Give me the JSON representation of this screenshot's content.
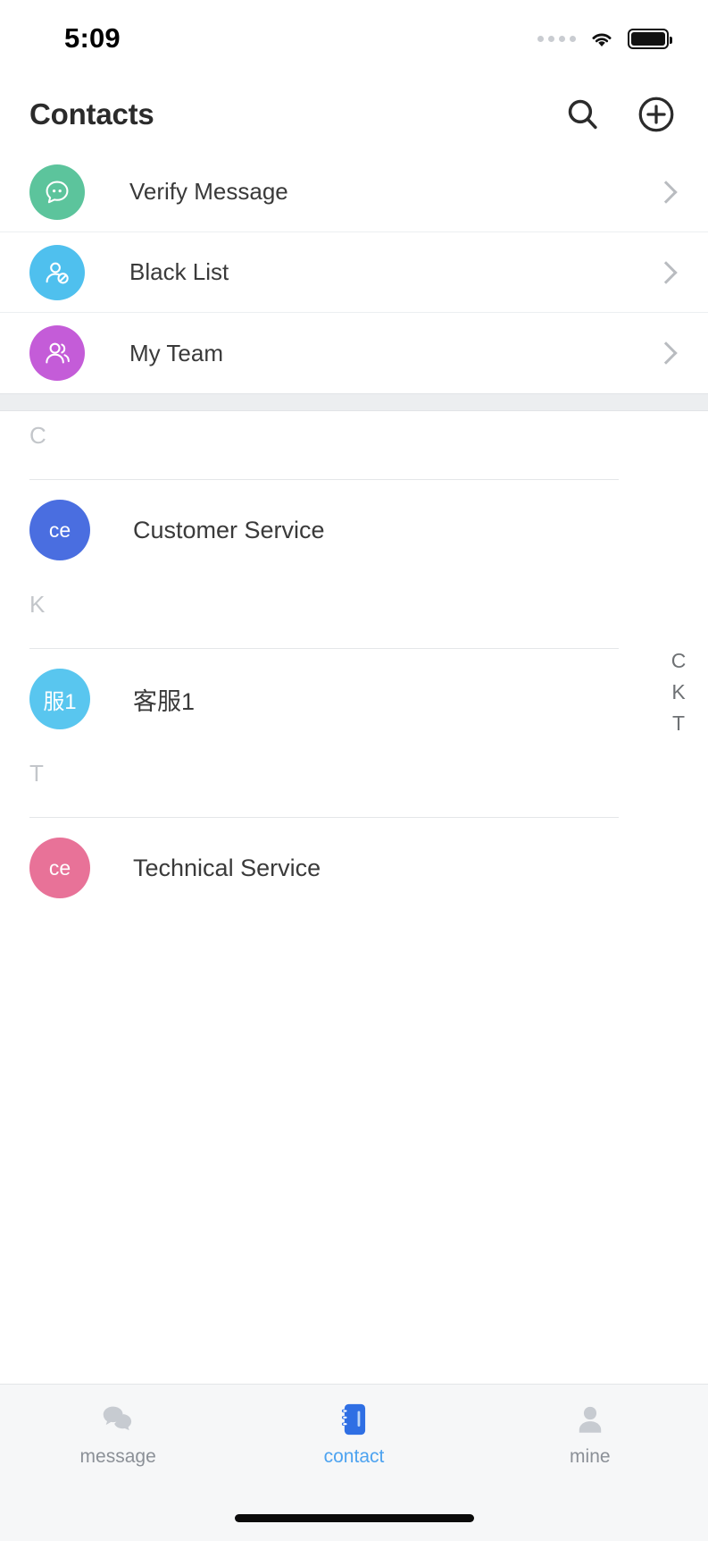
{
  "status_bar": {
    "time": "5:09",
    "signal_icon": "signal-dots-icon",
    "wifi_icon": "wifi-icon",
    "battery_icon": "battery-full-icon"
  },
  "header": {
    "title": "Contacts",
    "search_icon": "search-icon",
    "add_icon": "add-circle-icon"
  },
  "entries": [
    {
      "label": "Verify Message",
      "icon": "chat-bubble-icon",
      "color": "#5cc49c",
      "chevron": "chevron-right-icon"
    },
    {
      "label": "Black List",
      "icon": "user-blocked-icon",
      "color": "#4fc0ee",
      "chevron": "chevron-right-icon"
    },
    {
      "label": "My Team",
      "icon": "team-people-icon",
      "color": "#c45cd8",
      "chevron": "chevron-right-icon"
    }
  ],
  "sections": [
    {
      "letter": "C",
      "contacts": [
        {
          "name": "Customer Service",
          "initials": "ce",
          "color": "#4a6ee0"
        }
      ]
    },
    {
      "letter": "K",
      "contacts": [
        {
          "name": "客服1",
          "initials": "服1",
          "color": "#59c6ef"
        }
      ]
    },
    {
      "letter": "T",
      "contacts": [
        {
          "name": "Technical Service",
          "initials": "ce",
          "color": "#e87298"
        }
      ]
    }
  ],
  "index_bar": [
    "C",
    "K",
    "T"
  ],
  "tab_bar": [
    {
      "label": "message",
      "icon": "message-bubbles-icon",
      "active": false
    },
    {
      "label": "contact",
      "icon": "address-book-icon",
      "active": true
    },
    {
      "label": "mine",
      "icon": "person-icon",
      "active": false
    }
  ],
  "colors": {
    "accent": "#4da3f0",
    "tab_inactive": "#8b9097",
    "text_primary": "#3a3a3a",
    "section_letter": "#c3c6ca"
  }
}
